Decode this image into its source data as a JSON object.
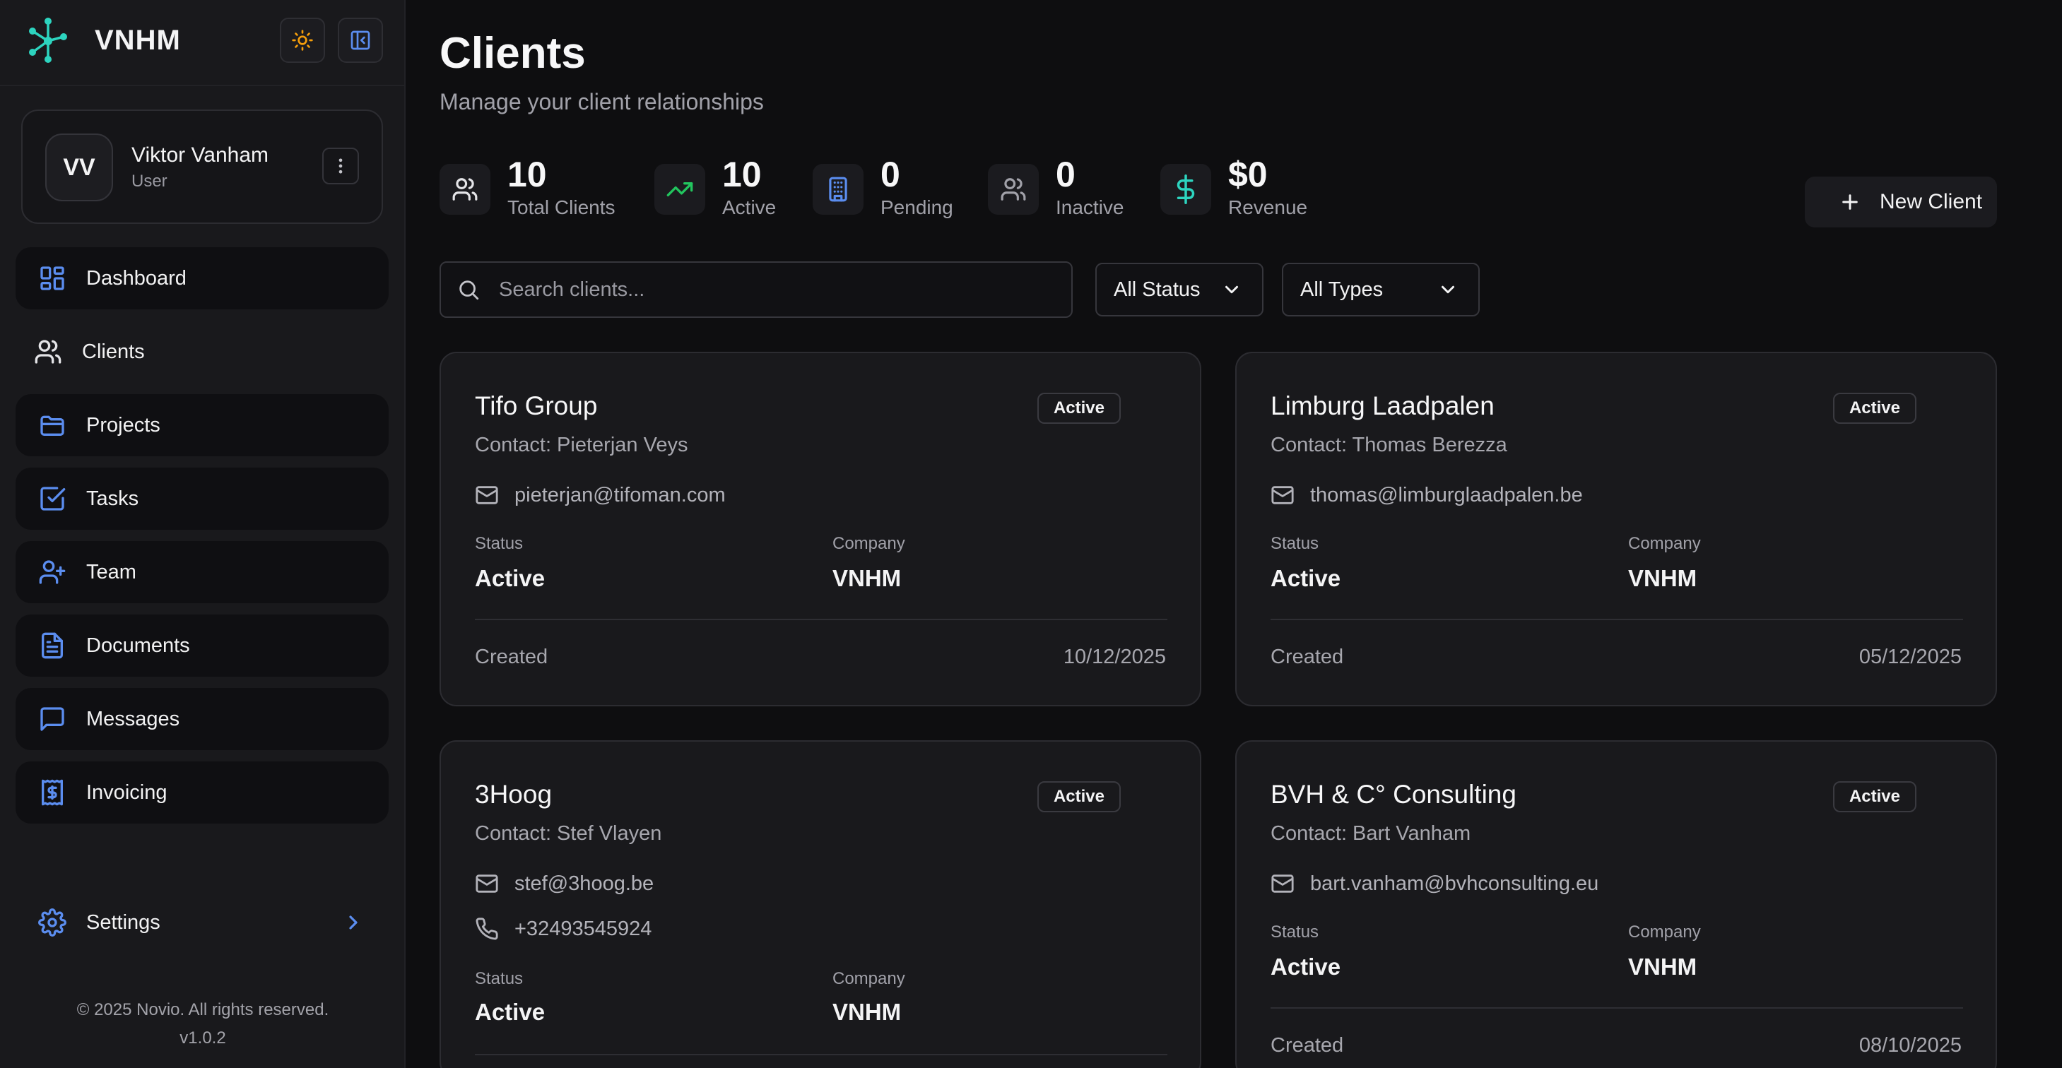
{
  "brand": {
    "name": "VNHM"
  },
  "header_buttons": {
    "theme_icon": "sun-icon",
    "collapse_icon": "sidebar-collapse-icon"
  },
  "user": {
    "initials": "VV",
    "name": "Viktor Vanham",
    "role": "User"
  },
  "nav": {
    "items": [
      {
        "label": "Dashboard",
        "icon": "dashboard-icon"
      },
      {
        "label": "Clients",
        "icon": "users-icon"
      },
      {
        "label": "Projects",
        "icon": "folder-icon"
      },
      {
        "label": "Tasks",
        "icon": "check-square-icon"
      },
      {
        "label": "Team",
        "icon": "user-plus-icon"
      },
      {
        "label": "Documents",
        "icon": "document-icon"
      },
      {
        "label": "Messages",
        "icon": "message-icon"
      },
      {
        "label": "Invoicing",
        "icon": "receipt-icon"
      }
    ],
    "settings_label": "Settings"
  },
  "footer": {
    "copyright": "© 2025 Novio. All rights reserved.",
    "version": "v1.0.2"
  },
  "page": {
    "title": "Clients",
    "subtitle": "Manage your client relationships"
  },
  "stats": [
    {
      "value": "10",
      "label": "Total Clients",
      "icon": "users-icon"
    },
    {
      "value": "10",
      "label": "Active",
      "icon": "trending-up-icon"
    },
    {
      "value": "0",
      "label": "Pending",
      "icon": "building-icon"
    },
    {
      "value": "0",
      "label": "Inactive",
      "icon": "users-icon"
    },
    {
      "value": "$0",
      "label": "Revenue",
      "icon": "dollar-icon"
    }
  ],
  "actions": {
    "new_client": "New Client"
  },
  "filters": {
    "search_placeholder": "Search clients...",
    "status_selected": "All Status",
    "type_selected": "All Types"
  },
  "labels": {
    "status": "Status",
    "company": "Company",
    "created": "Created"
  },
  "clients": [
    {
      "name": "Tifo Group",
      "badge": "Active",
      "contact": "Contact: Pieterjan Veys",
      "email": "pieterjan@tifoman.com",
      "phone": "",
      "status": "Active",
      "company": "VNHM",
      "created": "10/12/2025"
    },
    {
      "name": "Limburg Laadpalen",
      "badge": "Active",
      "contact": "Contact: Thomas Berezza",
      "email": "thomas@limburglaadpalen.be",
      "phone": "",
      "status": "Active",
      "company": "VNHM",
      "created": "05/12/2025"
    },
    {
      "name": "3Hoog",
      "badge": "Active",
      "contact": "Contact: Stef Vlayen",
      "email": "stef@3hoog.be",
      "phone": "+32493545924",
      "status": "Active",
      "company": "VNHM",
      "created": ""
    },
    {
      "name": "BVH & C° Consulting",
      "badge": "Active",
      "contact": "Contact: Bart Vanham",
      "email": "bart.vanham@bvhconsulting.eu",
      "phone": "",
      "status": "Active",
      "company": "VNHM",
      "created": "08/10/2025"
    }
  ],
  "colors": {
    "accent_blue": "#5b8def",
    "accent_teal": "#2dd4bf",
    "accent_green": "#22c55e",
    "sun": "#f59e0b"
  }
}
